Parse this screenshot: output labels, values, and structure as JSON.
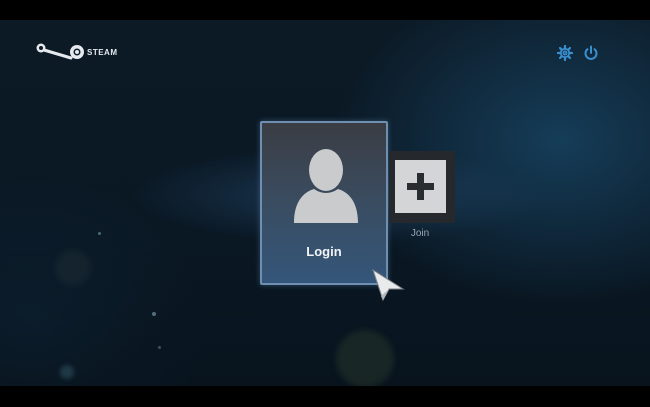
{
  "app": {
    "brand": "STEAM"
  },
  "header": {
    "icons": [
      "gear-icon",
      "power-icon"
    ]
  },
  "tiles": {
    "login": {
      "label": "Login",
      "icon": "user-silhouette-icon"
    },
    "join": {
      "label": "Join",
      "icon": "plus-icon"
    }
  },
  "colors": {
    "accent": "#3a8fd0",
    "background": "#0b1824",
    "tile_border": "#6e8fb0"
  }
}
